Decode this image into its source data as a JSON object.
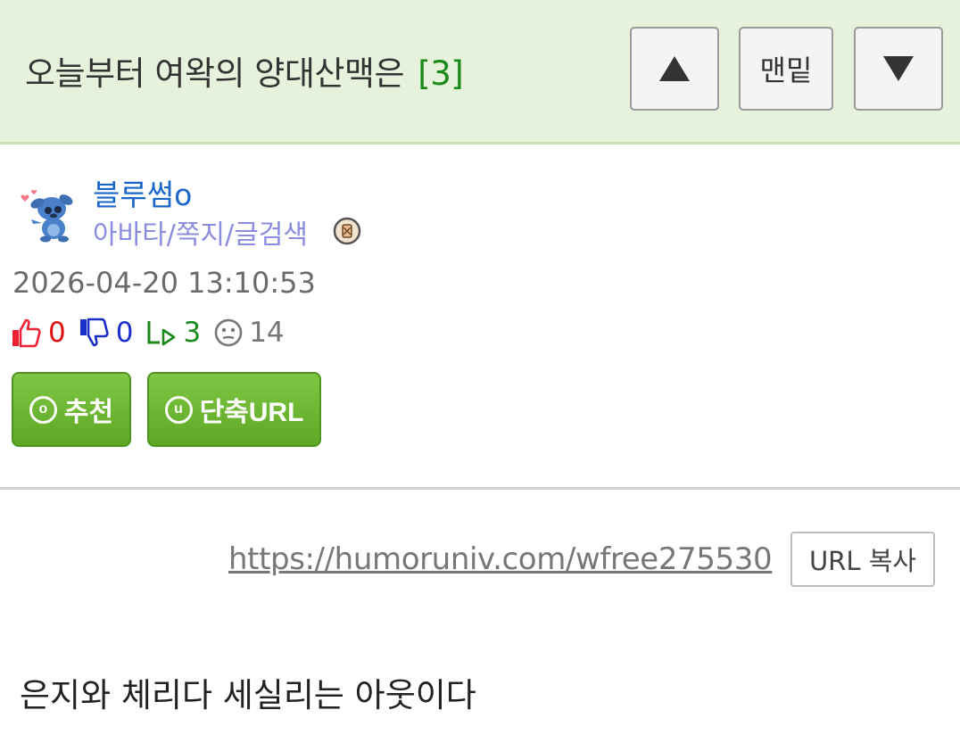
{
  "header": {
    "title": "오늘부터 여왁의 양대산맥은",
    "reply_count": "[3]",
    "up_icon": "triangle-up",
    "bottom_label": "맨밑",
    "down_icon": "triangle-down"
  },
  "author": {
    "name": "블루썸o",
    "menu": "아바타/쪽지/글검색",
    "avatar_icon": "stitch-avatar",
    "badge_icon": "level-badge"
  },
  "post": {
    "datetime": "2026-04-20 13:10:53",
    "likes": "0",
    "dislikes": "0",
    "replies": "3",
    "views": "14"
  },
  "actions": {
    "recommend_label": "추천",
    "recommend_icon": "ⓞ",
    "short_url_label": "단축URL",
    "short_url_icon": "u"
  },
  "link": {
    "url": "https://humoruniv.com/wfree275530",
    "copy_label": "URL 복사"
  },
  "body": {
    "text": "은지와 체리다 세실리는 아웃이다"
  },
  "colors": {
    "header_bg": "#e6f2dc",
    "count_green": "#1a8a1a",
    "username_blue": "#1a66c9",
    "menu_purple": "#8c8ce0",
    "button_green": "#6bb531"
  }
}
